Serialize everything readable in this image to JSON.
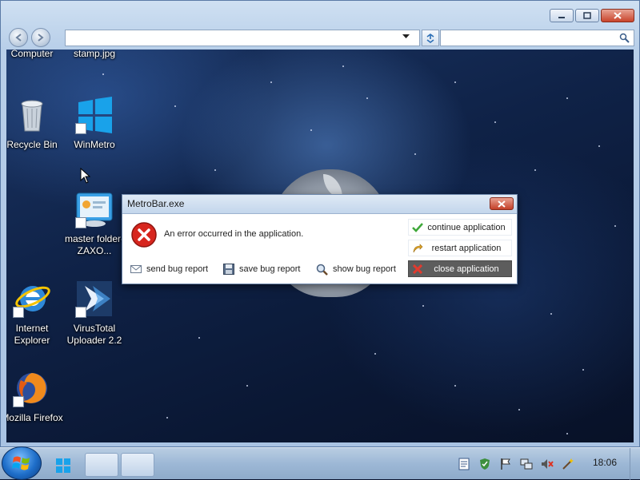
{
  "window": {
    "address_value": "",
    "search_placeholder": ""
  },
  "desktop": {
    "icons": [
      {
        "label": "Computer",
        "icon": "computer-icon"
      },
      {
        "label": "stamp.jpg",
        "icon": "image-file-icon"
      },
      {
        "label": "Recycle Bin",
        "icon": "recycle-bin-icon"
      },
      {
        "label": "WinMetro",
        "icon": "windows-logo-icon"
      },
      {
        "label": "master folder-ZAXO...",
        "icon": "folder-control-panel-icon"
      },
      {
        "label": "Internet Explorer",
        "icon": "internet-explorer-icon"
      },
      {
        "label": "VirusTotal Uploader 2.2",
        "icon": "virustotal-icon"
      },
      {
        "label": "Mozilla Firefox",
        "icon": "firefox-icon"
      }
    ]
  },
  "dialog": {
    "title": "MetroBar.exe",
    "message": "An error occurred in the application.",
    "actions": [
      {
        "label": "continue application",
        "icon": "checkmark-icon"
      },
      {
        "label": "restart application",
        "icon": "restart-arrow-icon"
      },
      {
        "label": "close application",
        "icon": "red-x-icon"
      }
    ],
    "bug_buttons": [
      {
        "label": "send bug report",
        "icon": "mail-icon"
      },
      {
        "label": "save bug report",
        "icon": "floppy-disk-icon"
      },
      {
        "label": "show bug report",
        "icon": "magnifier-icon"
      }
    ]
  },
  "taskbar": {
    "clock": "18:06",
    "tray_icons": [
      "document-icon",
      "security-shield-icon",
      "action-center-flag-icon",
      "network-icon",
      "volume-muted-icon",
      "wand-icon"
    ]
  },
  "colors": {
    "dialog_dark_button": "#5d5d5d",
    "error_red": "#d7261e",
    "accent_blue": "#1e6ec9"
  }
}
